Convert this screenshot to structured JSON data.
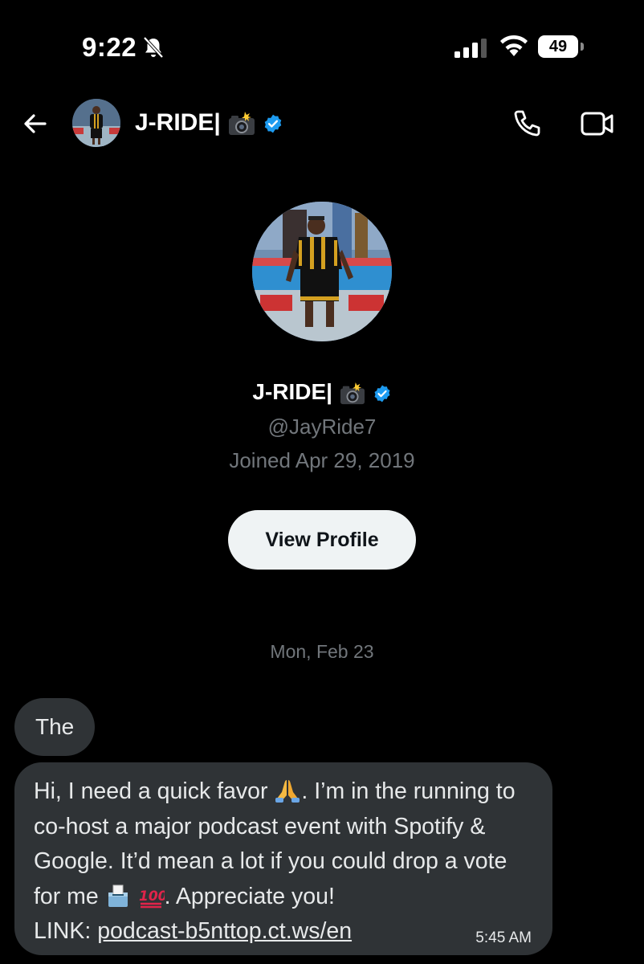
{
  "status_bar": {
    "time": "9:22",
    "battery": "49"
  },
  "header": {
    "name": "J-RIDE|"
  },
  "profile": {
    "name": "J-RIDE|",
    "handle": "@JayRide7",
    "joined": "Joined Apr 29, 2019",
    "view_profile_label": "View Profile"
  },
  "date_separator": "Mon, Feb 23",
  "messages": [
    {
      "text": "The"
    },
    {
      "text_part1": "Hi, I need a quick favor ",
      "text_part2": ". I’m in the running to co-host a major podcast event with Spotify & Google. It’d mean a lot if you could drop a vote for me ",
      "text_part3": ". Appreciate you!",
      "link_prefix": "LINK: ",
      "link": "podcast-b5nttop.ct.ws/en",
      "time": "5:45 AM"
    }
  ],
  "icons": {
    "back": "arrow-left-icon",
    "call": "phone-icon",
    "video": "video-camera-icon",
    "verified": "verified-badge-icon",
    "camera_flash_emoji": "camera-with-flash-icon",
    "praying_hands_emoji": "folded-hands-icon",
    "ballot_emoji": "ballot-box-icon",
    "hundred_emoji": "hundred-points-icon"
  },
  "colors": {
    "background": "#000000",
    "bubble": "#2f3336",
    "verified": "#1d9bf0",
    "muted": "#71767b",
    "button_bg": "#eff3f4"
  }
}
